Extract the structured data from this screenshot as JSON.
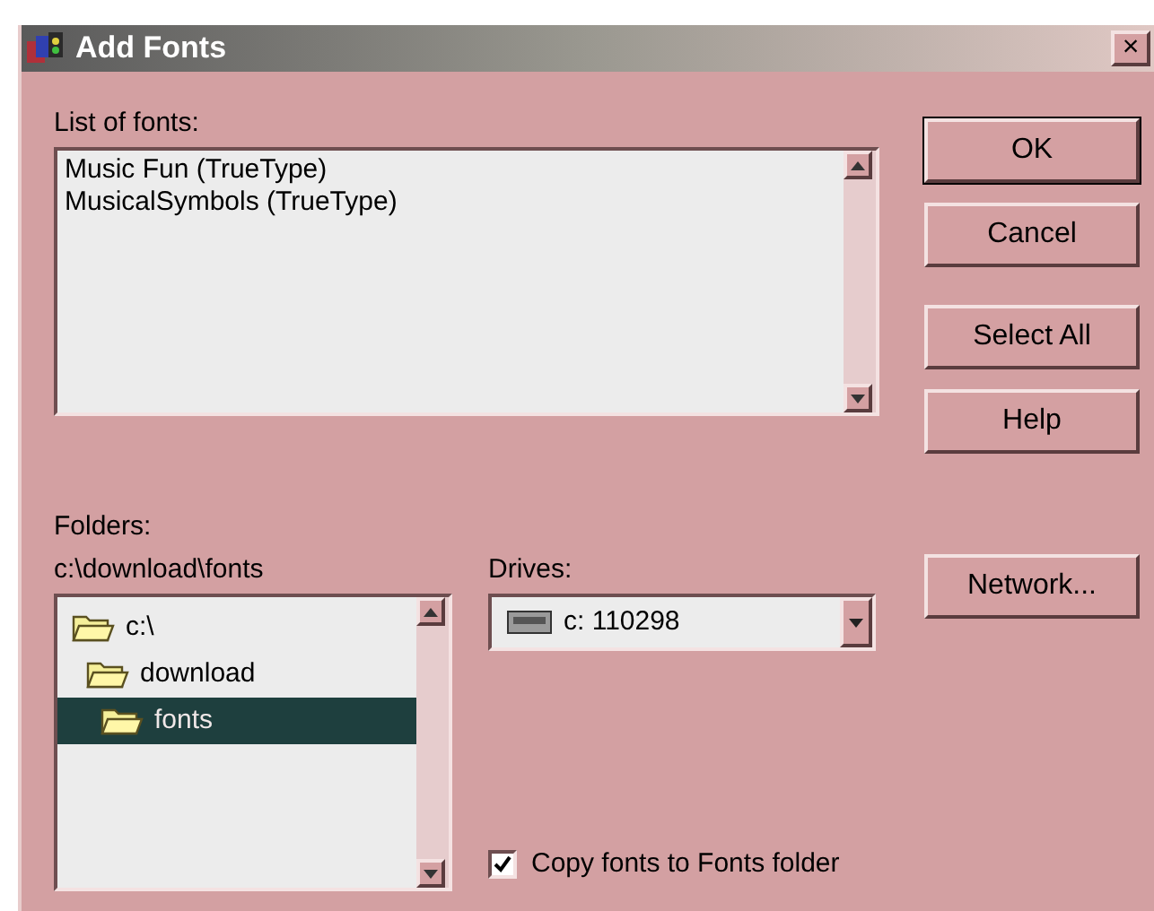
{
  "window": {
    "title": "Add Fonts",
    "close": "×"
  },
  "fonts_list": {
    "label": "List of fonts:",
    "items": [
      {
        "name": "Music Fun (TrueType)",
        "selected": false
      },
      {
        "name": "MusicalSymbols (TrueType)",
        "selected": false
      }
    ]
  },
  "buttons": [
    {
      "label": "OK",
      "default": true
    },
    {
      "label": "Cancel",
      "default": false
    },
    {
      "label": "Select All",
      "default": false
    },
    {
      "label": "Help",
      "default": false
    }
  ],
  "folders": {
    "label": "Folders:",
    "path": "c:\\download\\fonts",
    "tree": [
      {
        "name": "c:\\",
        "selected": false,
        "children": [
          {
            "name": "download",
            "selected": false,
            "children": [
              {
                "name": "fonts",
                "selected": true
              }
            ]
          }
        ]
      }
    ]
  },
  "drives": {
    "label": "Drives:",
    "value": "c: 110298"
  },
  "network_button": {
    "label": "Network..."
  },
  "copy_option": {
    "label": "Copy fonts to Fonts folder",
    "checked": true
  }
}
